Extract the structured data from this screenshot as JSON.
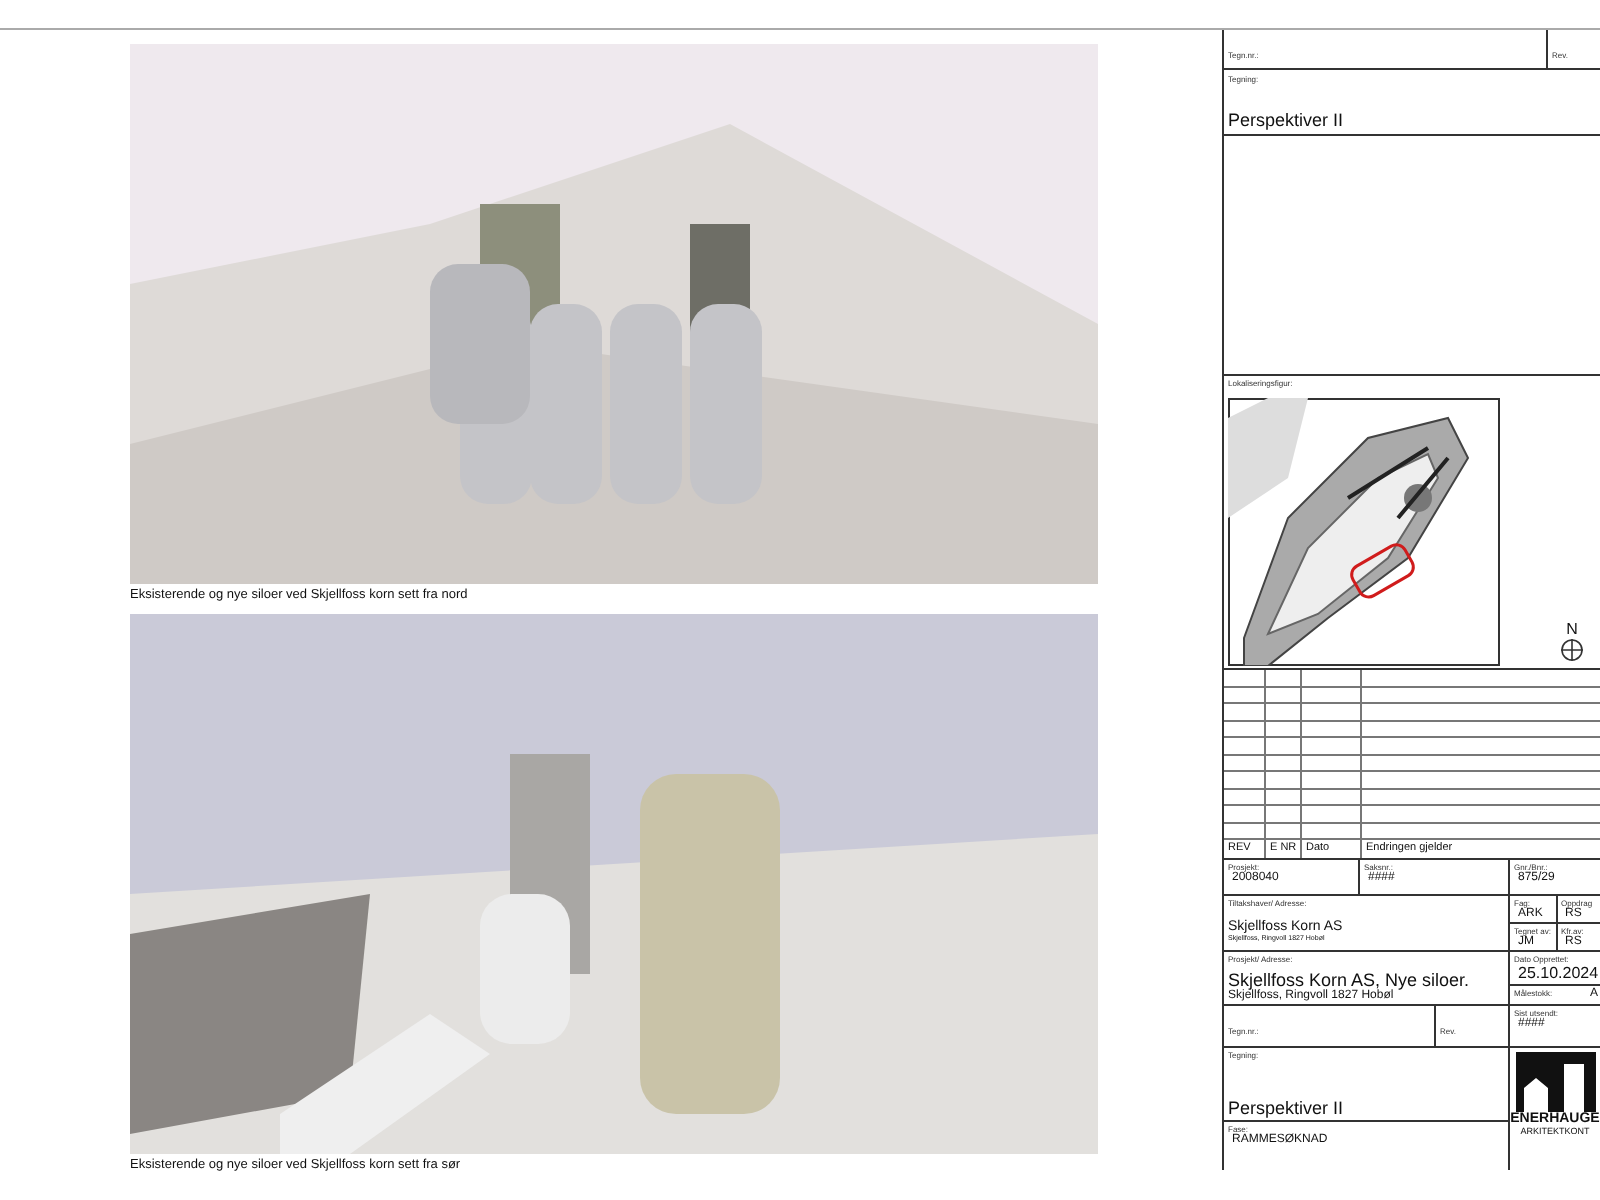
{
  "figures": [
    {
      "kind": "north",
      "caption": "Eksisterende og nye siloer ved Skjellfoss korn sett fra nord"
    },
    {
      "kind": "south",
      "caption": "Eksisterende og nye siloer ved Skjellfoss korn sett fra sør"
    }
  ],
  "title_block": {
    "top": {
      "drawing_no_label": "Tegn.nr.:",
      "rev_label": "Rev."
    },
    "drawing": {
      "label": "Tegning:",
      "title": "Perspektiver II"
    },
    "location": {
      "label": "Lokaliseringsfigur:",
      "north": "N"
    },
    "revisions": {
      "columns": [
        "REV",
        "E NR",
        "Dato",
        "Endringen gjelder"
      ]
    },
    "project_no": {
      "label": "Prosjekt:",
      "value": "2008040"
    },
    "case_no": {
      "label": "Saksnr.:",
      "value": "####"
    },
    "property_no": {
      "label": "Gnr./Bnr.:",
      "value": "875/29"
    },
    "client": {
      "label": "Tiltakshaver/ Adresse:",
      "name": "Skjellfoss Korn AS",
      "address": "Skjellfoss, Ringvoll 1827 Hobøl"
    },
    "discipline": {
      "label": "Fag:",
      "value": "ARK"
    },
    "responsible": {
      "label": "Oppdrag",
      "value": "RS"
    },
    "drawn_by": {
      "label": "Tegnet av:",
      "value": "JM"
    },
    "checked_by": {
      "label": "Kfr.av:",
      "value": "RS"
    },
    "project": {
      "label": "Prosjekt/ Adresse:",
      "name": "Skjellfoss Korn AS, Nye siloer.",
      "address": "Skjellfoss, Ringvoll 1827 Hobøl"
    },
    "created": {
      "label": "Dato Opprettet:",
      "value": "25.10.2024"
    },
    "scale": {
      "label": "Målestokk:",
      "value": "A"
    },
    "bottom": {
      "drawing_no_label": "Tegn.nr.:",
      "rev_label": "Rev.",
      "sent_label": "Sist utsendt:",
      "sent_value": "####"
    },
    "drawing_bottom": {
      "label": "Tegning:",
      "title": "Perspektiver II"
    },
    "phase": {
      "label": "Fase:",
      "value": "RAMMESØKNAD"
    },
    "logo": {
      "name": "ENERHAUGE",
      "subtitle": "ARKITEKTKONT"
    }
  }
}
